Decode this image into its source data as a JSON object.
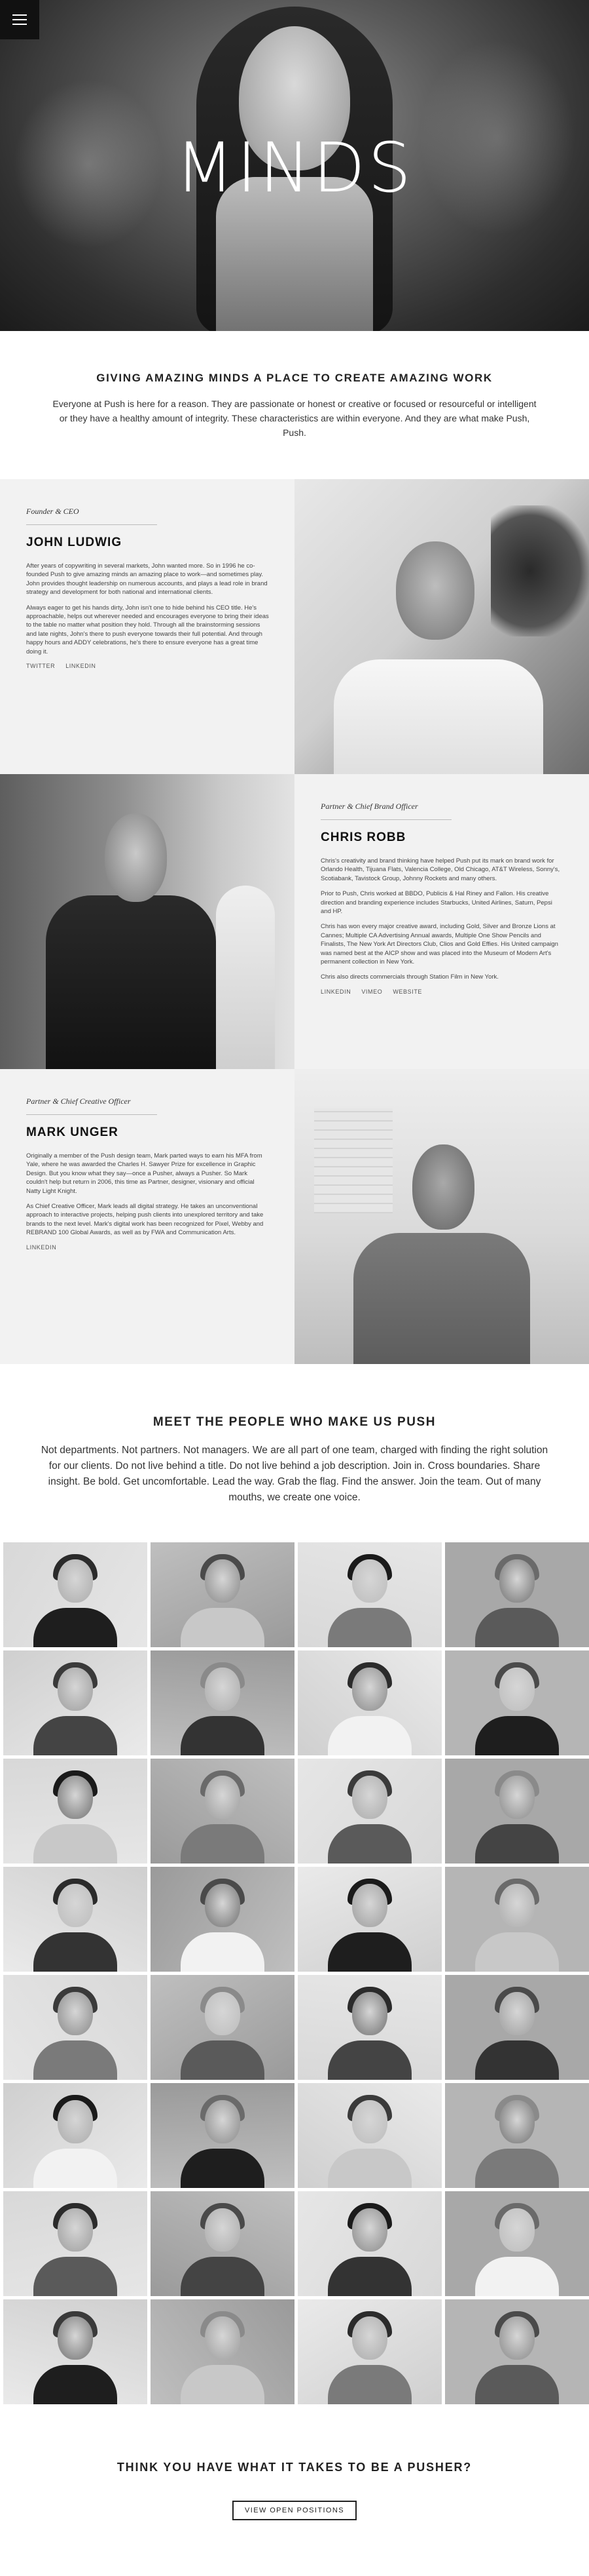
{
  "hero": {
    "title": "MINDS",
    "menu_icon": "hamburger-menu-icon"
  },
  "intro": {
    "heading": "GIVING AMAZING MINDS A PLACE TO CREATE AMAZING WORK",
    "body": "Everyone at Push is here for a reason. They are passionate or honest or creative or focused or resourceful or intelligent or they have a healthy amount of integrity. These characteristics are within everyone. And they are what make Push, Push."
  },
  "bios": [
    {
      "role": "Founder & CEO",
      "name": "JOHN LUDWIG",
      "paragraphs": [
        "After years of copywriting in several markets, John wanted more. So in 1996 he co-founded Push to give amazing minds an amazing place to work—and sometimes play. John provides thought leadership on numerous accounts, and plays a lead role in brand strategy and development for both national and international clients.",
        "Always eager to get his hands dirty, John isn't one to hide behind his CEO title. He's approachable, helps out wherever needed and encourages everyone to bring their ideas to the table no matter what position they hold. Through all the brainstorming sessions and late nights, John's there to push everyone towards their full potential. And through happy hours and ADDY celebrations, he's there to ensure everyone has a great time doing it."
      ],
      "links": [
        "TWITTER",
        "LINKEDIN"
      ]
    },
    {
      "role": "Partner & Chief Brand Officer",
      "name": "CHRIS ROBB",
      "paragraphs": [
        "Chris's creativity and brand thinking have helped Push put its mark on brand work for Orlando Health, Tijuana Flats, Valencia College, Old Chicago, AT&T Wireless, Sonny's, Scotiabank, Tavistock Group, Johnny Rockets and many others.",
        "Prior to Push, Chris worked at BBDO, Publicis & Hal Riney and Fallon. His creative direction and branding experience includes Starbucks, United Airlines, Saturn, Pepsi and HP.",
        "Chris has won every major creative award, including Gold, Silver and Bronze Lions at Cannes; Multiple CA Advertising Annual awards, Multiple One Show Pencils and Finalists, The New York Art Directors Club, Clios and Gold Effies. His United campaign was named best at the AICP show and was placed into the Museum of Modern Art's permanent collection in New York.",
        "Chris also directs commercials through Station Film in New York."
      ],
      "links": [
        "LINKEDIN",
        "VIMEO",
        "WEBSITE"
      ]
    },
    {
      "role": "Partner & Chief Creative Officer",
      "name": "MARK UNGER",
      "paragraphs": [
        "Originally a member of the Push design team, Mark parted ways to earn his MFA from Yale, where he was awarded the Charles H. Sawyer Prize for excellence in Graphic Design. But you know what they say—once a Pusher, always a Pusher. So Mark couldn't help but return in 2006, this time as Partner, designer, visionary and official Natty Light Knight.",
        "As Chief Creative Officer, Mark leads all digital strategy. He takes an unconventional approach to interactive projects, helping push clients into unexplored territory and take brands to the next level. Mark's digital work has been recognized for Pixel, Webby and REBRAND 100 Global Awards, as well as by FWA and Communication Arts."
      ],
      "links": [
        "LINKEDIN"
      ]
    }
  ],
  "team": {
    "heading": "MEET THE PEOPLE WHO MAKE US PUSH",
    "body": "Not departments. Not partners. Not managers. We are all part of one team, charged with finding the right solution for our clients. Do not live behind a title. Do not live behind a job description. Join in. Cross boundaries. Share insight. Be bold. Get uncomfortable. Lead the way. Grab the flag. Find the answer. Join the team. Out of many mouths, we create one voice."
  },
  "cta": {
    "heading": "THINK YOU HAVE WHAT IT TAKES TO BE A PUSHER?",
    "button": "VIEW OPEN POSITIONS"
  }
}
